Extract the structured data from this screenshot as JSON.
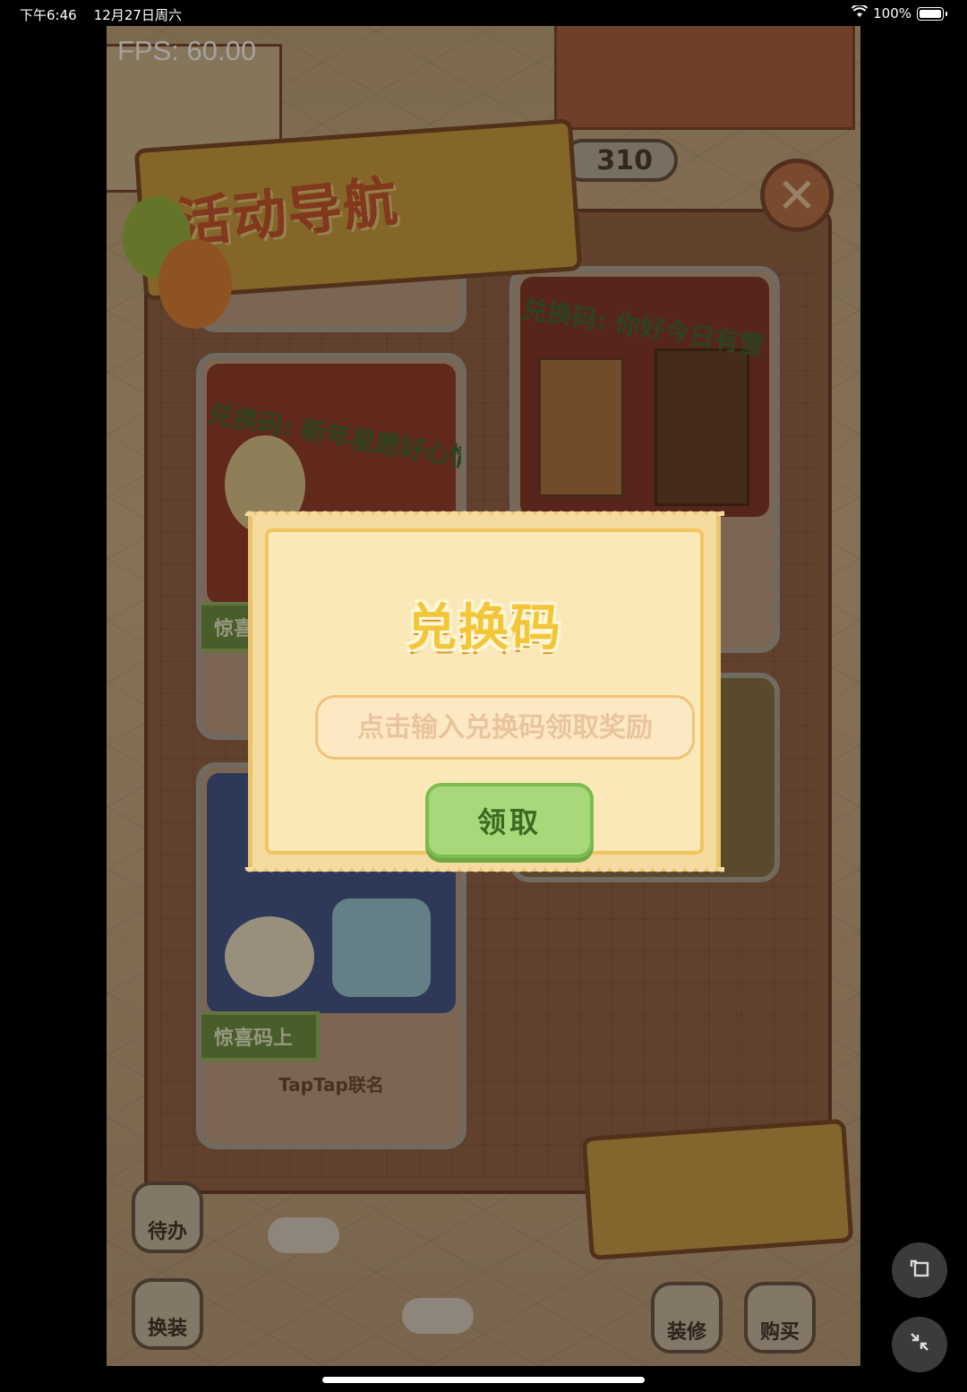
{
  "status_bar": {
    "time": "下午6:46",
    "date": "12月27日周六",
    "battery": "100%"
  },
  "game": {
    "fps": "FPS: 60.00",
    "coin_count": "310",
    "nav_title": "活动导航",
    "cards": [
      {
        "code_text": "兑换码: 你好今日有雪"
      },
      {
        "code_text": "兑换码: 新年星愿好心情",
        "tag": "惊喜"
      },
      {
        "tag": "惊喜码上",
        "caption": "TapTap联名"
      }
    ],
    "side_buttons": {
      "todo": "待办",
      "dressup": "换装",
      "renovate": "装修",
      "buy": "购买"
    }
  },
  "dialog": {
    "title": "兑换码",
    "input_placeholder": "点击输入兑换码领取奖励",
    "input_value": "",
    "claim_label": "领取"
  },
  "icons": [
    "wifi-icon",
    "battery-icon",
    "close-icon",
    "rotate-icon",
    "collapse-icon"
  ]
}
